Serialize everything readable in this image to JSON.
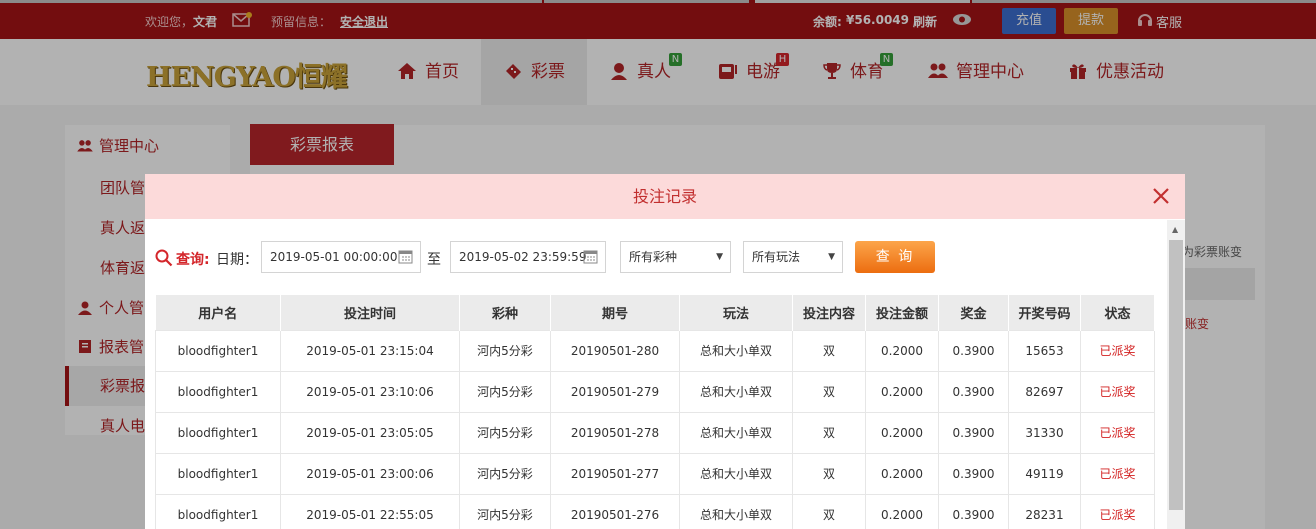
{
  "topbar": {
    "welcome": "欢迎您，",
    "username": "文君",
    "message_label": "预留信息：",
    "logout": "安全退出",
    "balance_label": "余额:",
    "balance_value": "¥56.0049",
    "refresh": "刷新",
    "recharge": "充值",
    "withdraw": "提款",
    "service": "客服"
  },
  "nav": {
    "logo": "HENGYAO恒耀",
    "items": [
      {
        "label": "首页"
      },
      {
        "label": "彩票"
      },
      {
        "label": "真人",
        "badge": "N"
      },
      {
        "label": "电游",
        "badge": "H"
      },
      {
        "label": "体育",
        "badge": "N"
      },
      {
        "label": "管理中心"
      },
      {
        "label": "优惠活动"
      }
    ]
  },
  "sidebar": {
    "items": [
      {
        "label": "管理中心"
      },
      {
        "label": "团队管"
      },
      {
        "label": "真人返"
      },
      {
        "label": "体育返"
      },
      {
        "label": "个人管"
      },
      {
        "label": "报表管"
      },
      {
        "label": "彩票报"
      },
      {
        "label": "真人电"
      }
    ]
  },
  "main": {
    "tab": "彩票报表",
    "right_partial_1": "为彩票账变",
    "right_partial_2": "账变"
  },
  "modal": {
    "title": "投注记录",
    "query_label": "查询:",
    "date_label": "日期：",
    "date_from": "2019-05-01 00:00:00",
    "to_label": "至",
    "date_to": "2019-05-02 23:59:59",
    "lottery_select": "所有彩种",
    "play_select": "所有玩法",
    "query_button": "查 询",
    "columns": [
      "用户名",
      "投注时间",
      "彩种",
      "期号",
      "玩法",
      "投注内容",
      "投注金额",
      "奖金",
      "开奖号码",
      "状态"
    ],
    "rows": [
      [
        "bloodfighter1",
        "2019-05-01 23:15:04",
        "河内5分彩",
        "20190501-280",
        "总和大小单双",
        "双",
        "0.2000",
        "0.3900",
        "15653",
        "已派奖"
      ],
      [
        "bloodfighter1",
        "2019-05-01 23:10:06",
        "河内5分彩",
        "20190501-279",
        "总和大小单双",
        "双",
        "0.2000",
        "0.3900",
        "82697",
        "已派奖"
      ],
      [
        "bloodfighter1",
        "2019-05-01 23:05:05",
        "河内5分彩",
        "20190501-278",
        "总和大小单双",
        "双",
        "0.2000",
        "0.3900",
        "31330",
        "已派奖"
      ],
      [
        "bloodfighter1",
        "2019-05-01 23:00:06",
        "河内5分彩",
        "20190501-277",
        "总和大小单双",
        "双",
        "0.2000",
        "0.3900",
        "49119",
        "已派奖"
      ],
      [
        "bloodfighter1",
        "2019-05-01 22:55:05",
        "河内5分彩",
        "20190501-276",
        "总和大小单双",
        "双",
        "0.2000",
        "0.3900",
        "28231",
        "已派奖"
      ]
    ]
  },
  "colors": {
    "brand_red": "#a51416",
    "header_pink": "#fcdada",
    "query_orange": "#ec6d10",
    "status_red": "#d21f1f"
  }
}
